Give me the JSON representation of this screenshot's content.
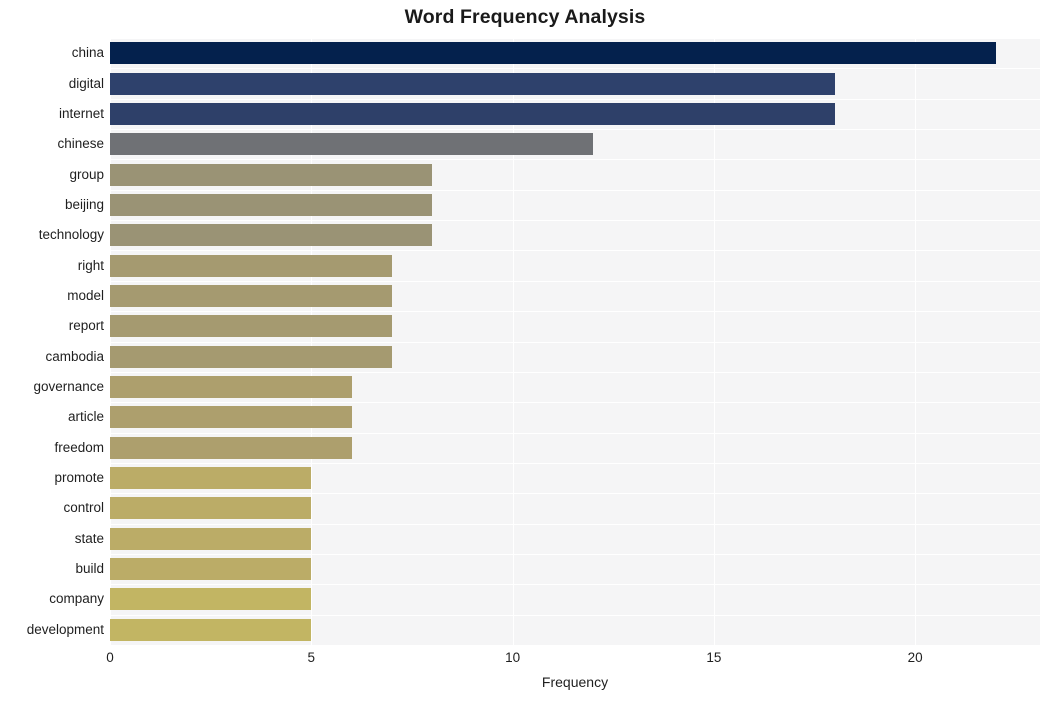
{
  "chart_data": {
    "type": "bar",
    "orientation": "horizontal",
    "title": "Word Frequency Analysis",
    "xlabel": "Frequency",
    "ylabel": "",
    "categories": [
      "china",
      "digital",
      "internet",
      "chinese",
      "group",
      "beijing",
      "technology",
      "right",
      "model",
      "report",
      "cambodia",
      "governance",
      "article",
      "freedom",
      "promote",
      "control",
      "state",
      "build",
      "company",
      "development"
    ],
    "values": [
      22,
      18,
      18,
      12,
      8,
      8,
      8,
      7,
      7,
      7,
      7,
      6,
      6,
      6,
      5,
      5,
      5,
      5,
      5,
      5
    ],
    "bar_colors": [
      "#04214d",
      "#2e416c",
      "#2e4069",
      "#6f7175",
      "#9a9375",
      "#9a9375",
      "#9a9375",
      "#a59a70",
      "#a59a70",
      "#a59a70",
      "#a59a70",
      "#ad9f6d",
      "#ad9f6d",
      "#ad9f6d",
      "#bbac67",
      "#bbac67",
      "#bbac67",
      "#bbac67",
      "#c2b563",
      "#c2b563"
    ],
    "xlim": [
      0,
      23.1
    ],
    "xticks": [
      0,
      5,
      10,
      15,
      20
    ],
    "xtick_labels": [
      "0",
      "5",
      "10",
      "15",
      "20"
    ],
    "grid": true,
    "grid_color": "#ffffff",
    "plot_background": "#f5f5f6",
    "figure_background": "#ffffff",
    "legend": "none"
  }
}
